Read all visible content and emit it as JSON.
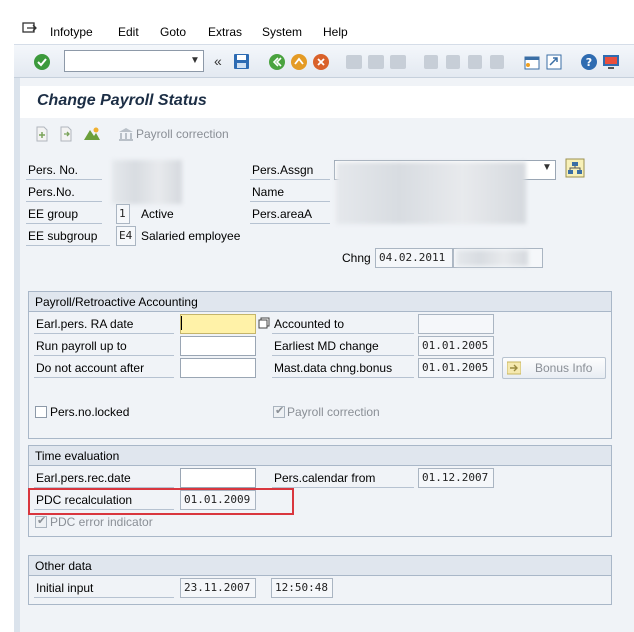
{
  "menu": [
    "Infotype",
    "Edit",
    "Goto",
    "Extras",
    "System",
    "Help"
  ],
  "toolbar": {
    "command_value": "",
    "icons": [
      "ok-icon",
      "back-double-icon",
      "save-icon",
      "back-icon",
      "exit-icon",
      "cancel-icon",
      "print-icon",
      "find-icon",
      "find-next-icon",
      "first-page-icon",
      "prev-page-icon",
      "next-page-icon",
      "last-page-icon",
      "new-session-icon",
      "shortcut-icon",
      "help-icon",
      "customize-icon"
    ]
  },
  "title": "Change Payroll Status",
  "app_toolbar": {
    "payroll_correction_label": "Payroll correction"
  },
  "header": {
    "pers_no_label": "Pers. No.",
    "pers_no2_label": "Pers.No.",
    "ee_group_label": "EE group",
    "ee_group_code": "1",
    "ee_group_text": "Active",
    "ee_subgroup_label": "EE subgroup",
    "ee_subgroup_code": "E4",
    "ee_subgroup_text": "Salaried employee",
    "pers_assgn_label": "Pers.Assgn",
    "name_label": "Name",
    "pers_area_label": "Pers.areaA",
    "chng_label": "Chng",
    "chng_date": "04.02.2011"
  },
  "payroll_group": {
    "title": "Payroll/Retroactive Accounting",
    "earl_ra_label": "Earl.pers. RA date",
    "earl_ra_value": "",
    "run_payroll_label": "Run payroll up to",
    "run_payroll_value": "",
    "do_not_account_label": "Do not account after",
    "do_not_account_value": "",
    "accounted_to_label": "Accounted to",
    "accounted_to_value": "",
    "earliest_md_label": "Earliest MD change",
    "earliest_md_value": "01.01.2005",
    "mast_data_label": "Mast.data chng.bonus",
    "mast_data_value": "01.01.2005",
    "bonus_info_label": "Bonus Info",
    "pers_locked_label": "Pers.no.locked",
    "payroll_correction_label": "Payroll correction"
  },
  "time_group": {
    "title": "Time evaluation",
    "earl_rec_label": "Earl.pers.rec.date",
    "earl_rec_value": "",
    "pers_calendar_label": "Pers.calendar from",
    "pers_calendar_value": "01.12.2007",
    "pdc_recalc_label": "PDC recalculation",
    "pdc_recalc_value": "01.01.2009",
    "pdc_error_label": "PDC error indicator"
  },
  "other_group": {
    "title": "Other data",
    "initial_input_label": "Initial input",
    "initial_input_date": "23.11.2007",
    "initial_input_time": "12:50:48"
  },
  "colors": {
    "highlight_box": "#d9363e",
    "required_field": "#fff2a8",
    "frame": "#f0f3f7"
  }
}
